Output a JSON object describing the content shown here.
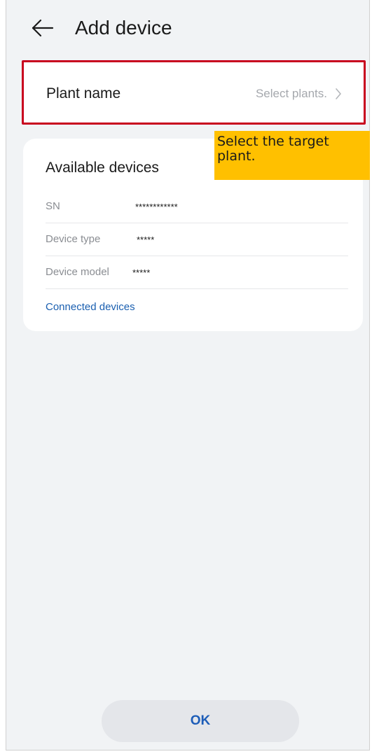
{
  "header": {
    "back_icon": "arrow-left-icon",
    "title": "Add device"
  },
  "plant": {
    "label": "Plant name",
    "placeholder": "Select plants.",
    "chevron_icon": "chevron-right-icon",
    "highlight_color": "#c8001e"
  },
  "devices": {
    "title": "Available devices",
    "rows": [
      {
        "label": "SN",
        "value": "************"
      },
      {
        "label": "Device type",
        "value": "*****"
      },
      {
        "label": "Device model",
        "value": "*****"
      }
    ],
    "connected_link": "Connected devices"
  },
  "callout": {
    "text": "Select the target plant.",
    "color": "#ffc000"
  },
  "footer": {
    "ok_label": "OK"
  },
  "colors": {
    "background": "#f1f3f5",
    "link": "#1a5fb0",
    "button_bg": "#e4e6ea",
    "button_text": "#1d5db8"
  }
}
